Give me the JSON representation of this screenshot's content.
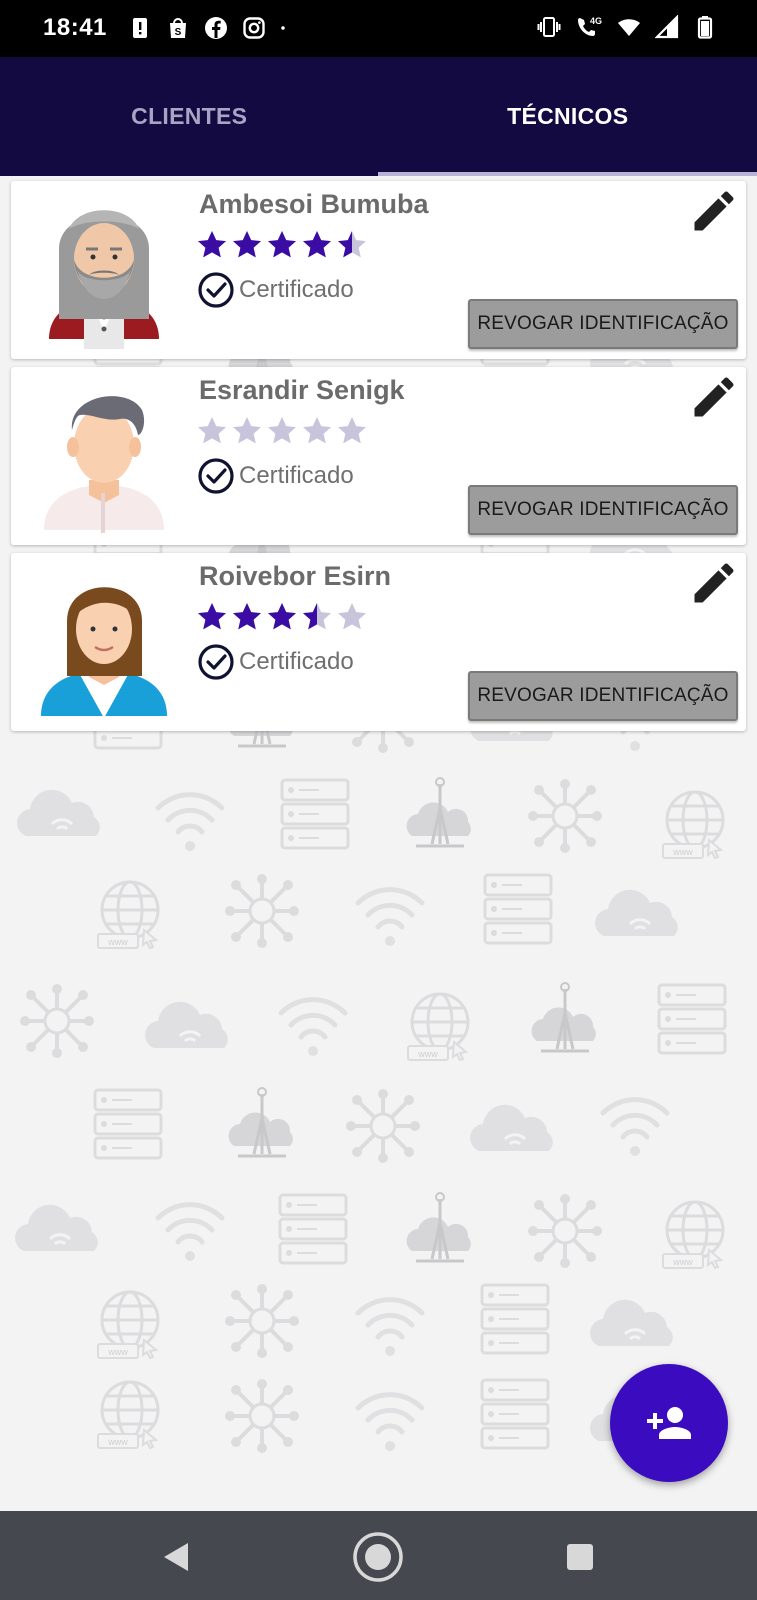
{
  "status_bar": {
    "time": "18:41",
    "left_icons": [
      "alert-icon",
      "shopping-bag-icon",
      "facebook-icon",
      "instagram-icon",
      "dot-icon"
    ],
    "right_icons": [
      "vibrate-icon",
      "wifi-call-4g-icon",
      "wifi-icon",
      "signal-icon",
      "battery-icon"
    ],
    "network_label": "4G"
  },
  "tabs": [
    {
      "label": "CLIENTES",
      "active": false
    },
    {
      "label": "TÉCNICOS",
      "active": true
    }
  ],
  "technicians": [
    {
      "name": "Ambesoi Bumuba",
      "rating": 4.5,
      "max_rating": 5,
      "certified_label": "Certificado",
      "revoke_label": "REVOGAR IDENTIFICAÇÃO",
      "avatar": "old-man-beard-avatar"
    },
    {
      "name": "Esrandir Senigk",
      "rating": 0,
      "max_rating": 5,
      "certified_label": "Certificado",
      "revoke_label": "REVOGAR IDENTIFICAÇÃO",
      "avatar": "faceless-man-avatar"
    },
    {
      "name": "Roivebor Esirn",
      "rating": 3.5,
      "max_rating": 5,
      "certified_label": "Certificado",
      "revoke_label": "REVOGAR IDENTIFICAÇÃO",
      "avatar": "woman-avatar"
    }
  ],
  "fab": {
    "icon": "add-person-icon"
  },
  "nav": {
    "back": "back-icon",
    "home": "home-icon",
    "recents": "recents-icon"
  },
  "colors": {
    "tab_bar": "#130a41",
    "star_filled": "#3a0ca3",
    "star_empty": "#c7c4dc",
    "fab": "#3b0bc0",
    "revoke_button": "#9c9c9c",
    "nav_bar": "#45484e"
  }
}
